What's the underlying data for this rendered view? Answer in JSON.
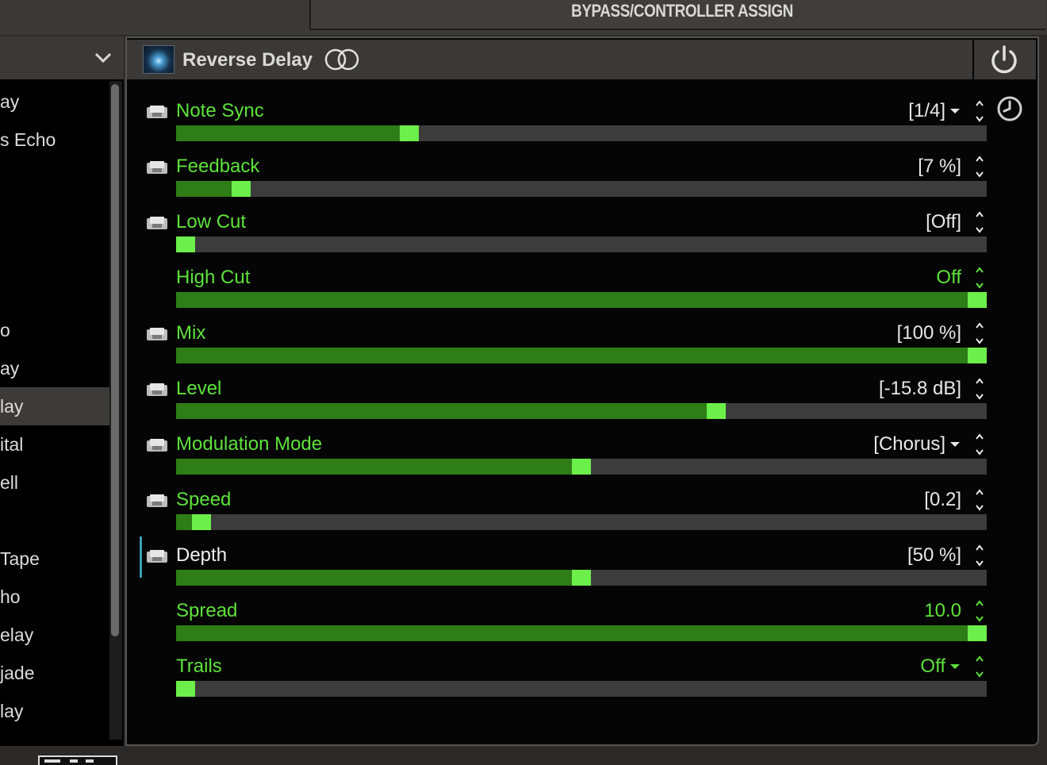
{
  "assign_tab": {
    "label": "BYPASS/CONTROLLER ASSIGN"
  },
  "sidebar": {
    "items": [
      {
        "label": "ay",
        "selected": false,
        "top": 0
      },
      {
        "label": "s Echo",
        "selected": false
      },
      {
        "label": "o",
        "selected": false
      },
      {
        "label": "ay",
        "selected": false
      },
      {
        "label": "lay",
        "selected": true
      },
      {
        "label": "ital",
        "selected": false
      },
      {
        "label": "ell",
        "selected": false
      },
      {
        "label": "Tape",
        "selected": false
      },
      {
        "label": "ho",
        "selected": false
      },
      {
        "label": "elay",
        "selected": false
      },
      {
        "label": "jade",
        "selected": false
      },
      {
        "label": "lay",
        "selected": false
      }
    ]
  },
  "block": {
    "title": "Reverse Delay",
    "link_icon": "stereo-link-icon",
    "power_icon": "power-icon",
    "tempo_icon": "tempo-clock-icon"
  },
  "params": [
    {
      "name": "Note Sync",
      "value": "[1/4]",
      "dropdown": true,
      "value_green": false,
      "has_pedal": true,
      "level": 0.283
    },
    {
      "name": "Feedback",
      "value": "[7 %]",
      "dropdown": false,
      "value_green": false,
      "has_pedal": true,
      "level": 0.07
    },
    {
      "name": "Low Cut",
      "value": "[Off]",
      "dropdown": false,
      "value_green": false,
      "has_pedal": true,
      "level": 0.0
    },
    {
      "name": "High Cut",
      "value": "Off",
      "dropdown": false,
      "value_green": true,
      "has_pedal": false,
      "level": 1.0
    },
    {
      "name": "Mix",
      "value": "[100 %]",
      "dropdown": false,
      "value_green": false,
      "has_pedal": true,
      "level": 1.0
    },
    {
      "name": "Level",
      "value": "[-15.8 dB]",
      "dropdown": false,
      "value_green": false,
      "has_pedal": true,
      "level": 0.67
    },
    {
      "name": "Modulation Mode",
      "value": "[Chorus]",
      "dropdown": true,
      "value_green": false,
      "has_pedal": true,
      "level": 0.5
    },
    {
      "name": "Speed",
      "value": "[0.2]",
      "dropdown": false,
      "value_green": false,
      "has_pedal": true,
      "level": 0.02
    },
    {
      "name": "Depth",
      "value": "[50 %]",
      "dropdown": false,
      "value_green": false,
      "has_pedal": true,
      "level": 0.5,
      "focused": true
    },
    {
      "name": "Spread",
      "value": "10.0",
      "dropdown": false,
      "value_green": true,
      "has_pedal": false,
      "level": 1.0
    },
    {
      "name": "Trails",
      "value": "Off",
      "dropdown": true,
      "value_green": true,
      "has_pedal": false,
      "level": 0.0
    }
  ],
  "colors": {
    "accent_green": "#5ee23b",
    "slider_fill": "#2e7d17",
    "slider_knob": "#6cef4a",
    "track": "#3c3c3c"
  }
}
